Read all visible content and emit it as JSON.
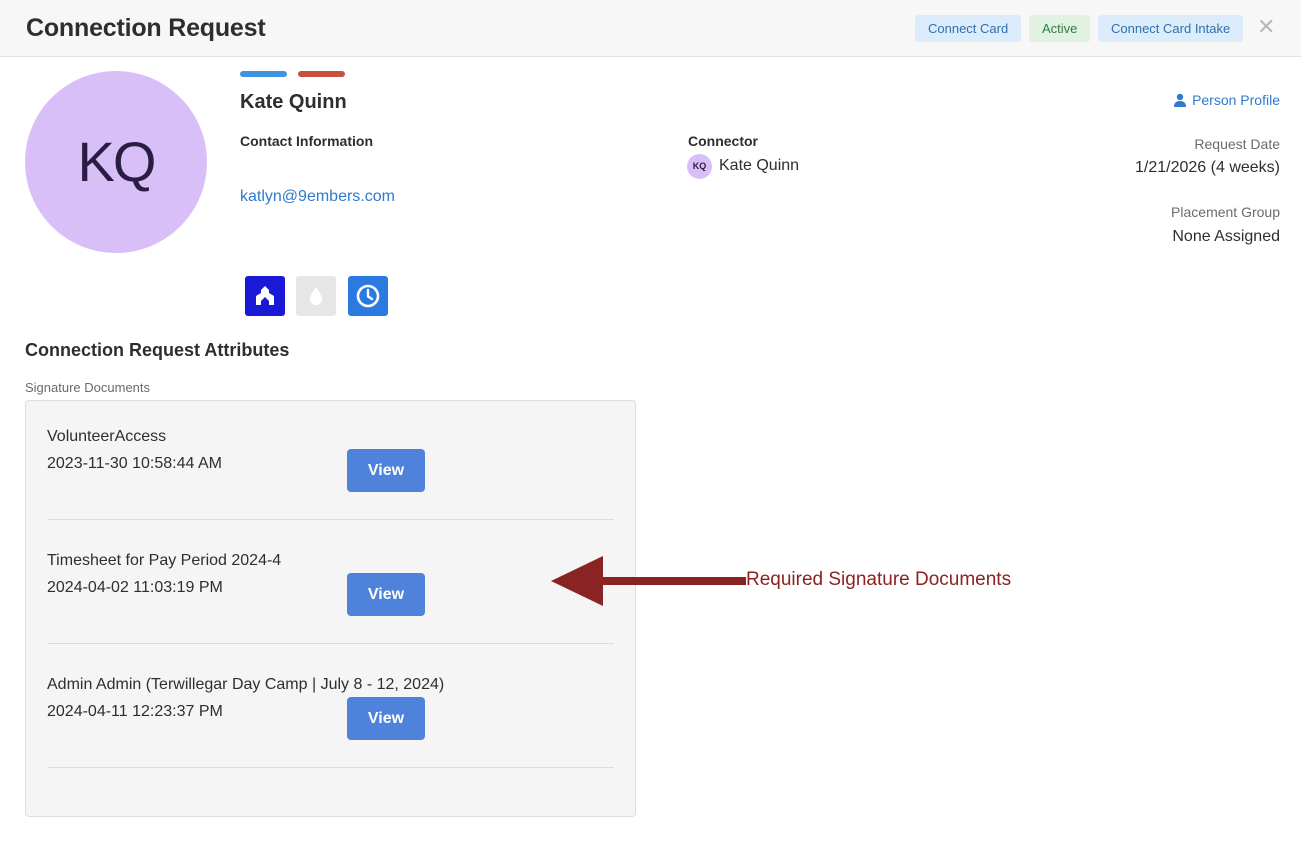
{
  "header": {
    "title": "Connection Request",
    "badges": {
      "type": "Connect Card",
      "status": "Active",
      "campaign": "Connect Card Intake"
    },
    "close_glyph": "✕"
  },
  "person": {
    "initials": "KQ",
    "name": "Kate Quinn",
    "contact_label": "Contact Information",
    "email": "katlyn@9embers.com",
    "avatar_color": "#d9bff7",
    "status_bar_colors": [
      "#3f94df",
      "#c9503d"
    ]
  },
  "connector": {
    "label": "Connector",
    "initials": "KQ",
    "name": "Kate Quinn"
  },
  "side": {
    "profile_link": "Person Profile",
    "request_date_label": "Request Date",
    "request_date_value": "1/21/2026 (4 weeks)",
    "placement_group_label": "Placement Group",
    "placement_group_value": "None Assigned"
  },
  "status_icons": [
    {
      "name": "organization-icon",
      "color": "#1a1ad6"
    },
    {
      "name": "drop-icon",
      "color": "#e7e7e7"
    },
    {
      "name": "clock-icon",
      "color": "#2b7ae0"
    }
  ],
  "attributes": {
    "section_title": "Connection Request Attributes",
    "field_label": "Signature Documents",
    "documents": [
      {
        "name": "VolunteerAccess",
        "date": "2023-11-30 10:58:44 AM",
        "button": "View"
      },
      {
        "name": "Timesheet for Pay Period 2024-4",
        "date": "2024-04-02 11:03:19 PM",
        "button": "View"
      },
      {
        "name": "Admin Admin (Terwillegar Day Camp | July 8 - 12, 2024)",
        "date": "2024-04-11 12:23:37 PM",
        "button": "View"
      }
    ]
  },
  "annotation": {
    "text": "Required Signature Documents",
    "color": "#8a2323"
  }
}
